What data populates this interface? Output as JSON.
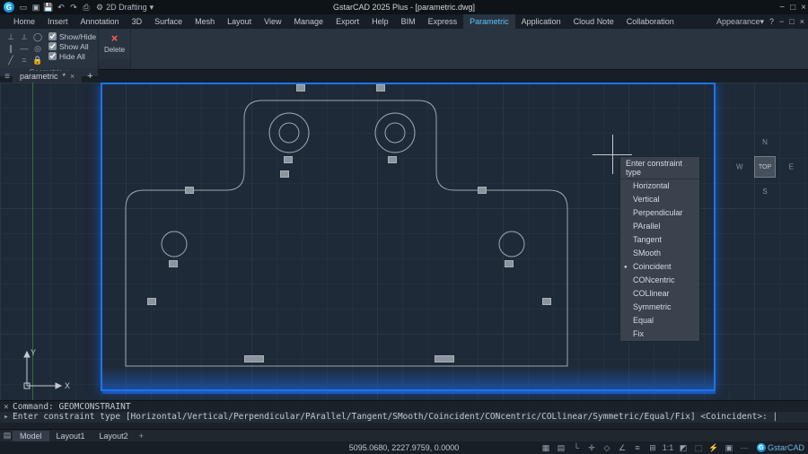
{
  "title": "GstarCAD 2025 Plus - [parametric.dwg]",
  "quick_access": {
    "workspace": "2D Drafting"
  },
  "window_controls": {
    "min": "−",
    "max": "□",
    "close": "×"
  },
  "menubar": {
    "items": [
      "Home",
      "Insert",
      "Annotation",
      "3D",
      "Surface",
      "Mesh",
      "Layout",
      "View",
      "Manage",
      "Export",
      "Help",
      "BIM",
      "Express",
      "Parametric",
      "Application",
      "Cloud Note",
      "Collaboration"
    ],
    "active": "Parametric",
    "right": {
      "appearance": "Appearance",
      "help_icon": "?"
    }
  },
  "ribbon": {
    "geometric_panel": {
      "label": "Geometric",
      "showhide": "Show/Hide",
      "showall": "Show All",
      "hideall": "Hide All",
      "dropdown": "▾"
    },
    "delete_panel": {
      "label": "Delete"
    }
  },
  "document_tabs": {
    "active": "parametric",
    "mark": "*",
    "close": "×",
    "add": "+"
  },
  "context_menu": {
    "header": "Enter constraint type",
    "items": [
      "Horizontal",
      "Vertical",
      "Perpendicular",
      "PArallel",
      "Tangent",
      "SMooth",
      "Coincident",
      "CONcentric",
      "COLlinear",
      "Symmetric",
      "Equal",
      "Fix"
    ],
    "selected": "Coincident"
  },
  "viewcube": {
    "top": "TOP",
    "n": "N",
    "s": "S",
    "e": "E",
    "w": "W"
  },
  "ucs": {
    "x": "X",
    "y": "Y"
  },
  "command": {
    "history": "Command: GEOMCONSTRAINT",
    "prompt": "Enter constraint type [Horizontal/Vertical/Perpendicular/PArallel/Tangent/SMooth/Coincident/CONcentric/COLlinear/Symmetric/Equal/Fix] <Coincident>:"
  },
  "model_tabs": {
    "items": [
      "Model",
      "Layout1",
      "Layout2"
    ],
    "active": "Model",
    "add": "+"
  },
  "statusbar": {
    "coords": "5095.0680, 2227.9759, 0.0000",
    "scale": "1:1",
    "brand": "GstarCAD"
  }
}
